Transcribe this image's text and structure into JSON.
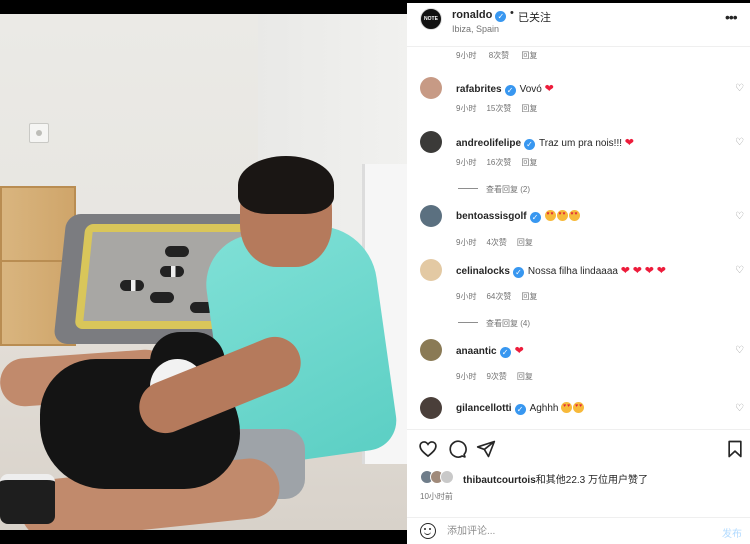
{
  "post": {
    "header": {
      "username": "ronaldo",
      "avatar_text": "NOTE",
      "separator": "•",
      "follow_status": "已关注",
      "location": "Ibiza, Spain"
    },
    "comments_partial_meta": {
      "time": "9小时",
      "likes": "8次赞",
      "reply": "回复"
    },
    "comments": [
      {
        "username": "rafabrites",
        "body": "Vovó",
        "hearts": 1,
        "eyes": 0,
        "time": "9小时",
        "likes": "15次赞",
        "reply": "回复",
        "avatar_color": "#c79a85"
      },
      {
        "username": "andreolifelipe",
        "body": "Traz um pra nois!!!",
        "hearts": 1,
        "eyes": 0,
        "time": "9小时",
        "likes": "16次赞",
        "reply": "回复",
        "view_replies": "查看回复 (2)",
        "avatar_color": "#3b3a38"
      },
      {
        "username": "bentoassisgolf",
        "body": "",
        "hearts": 0,
        "eyes": 3,
        "time": "9小时",
        "likes": "4次赞",
        "reply": "回复",
        "avatar_color": "#5b7080"
      },
      {
        "username": "celinalocks",
        "body": "Nossa filha lindaaaa",
        "hearts": 4,
        "eyes": 0,
        "time": "9小时",
        "likes": "64次赞",
        "reply": "回复",
        "view_replies": "查看回复 (4)",
        "avatar_color": "#e3c9a3"
      },
      {
        "username": "anaantic",
        "body": "",
        "hearts": 1,
        "eyes": 0,
        "time": "9小时",
        "likes": "9次赞",
        "reply": "回复",
        "avatar_color": "#8a7a55"
      },
      {
        "username": "gilancellotti",
        "body": "Aghhh",
        "hearts": 0,
        "eyes": 2,
        "avatar_color": "#4a3f3a"
      }
    ],
    "likes": {
      "prefix_user": "thibautcourtois",
      "text": "和其他22.3 万位用户赞了",
      "avatar_colors": [
        "#6f7d8a",
        "#a08a7a",
        "#c9c9c9"
      ]
    },
    "time_ago": "10小时前",
    "composer": {
      "placeholder": "添加评论...",
      "post_label": "发布"
    },
    "colors": {
      "verified": "#3897f0",
      "heart": "#ed1c3b",
      "post_disabled": "#b3dbff"
    },
    "icons": [
      "heart-icon",
      "comment-icon",
      "share-icon",
      "bookmark-icon",
      "more-options-icon",
      "emoji-icon"
    ]
  }
}
